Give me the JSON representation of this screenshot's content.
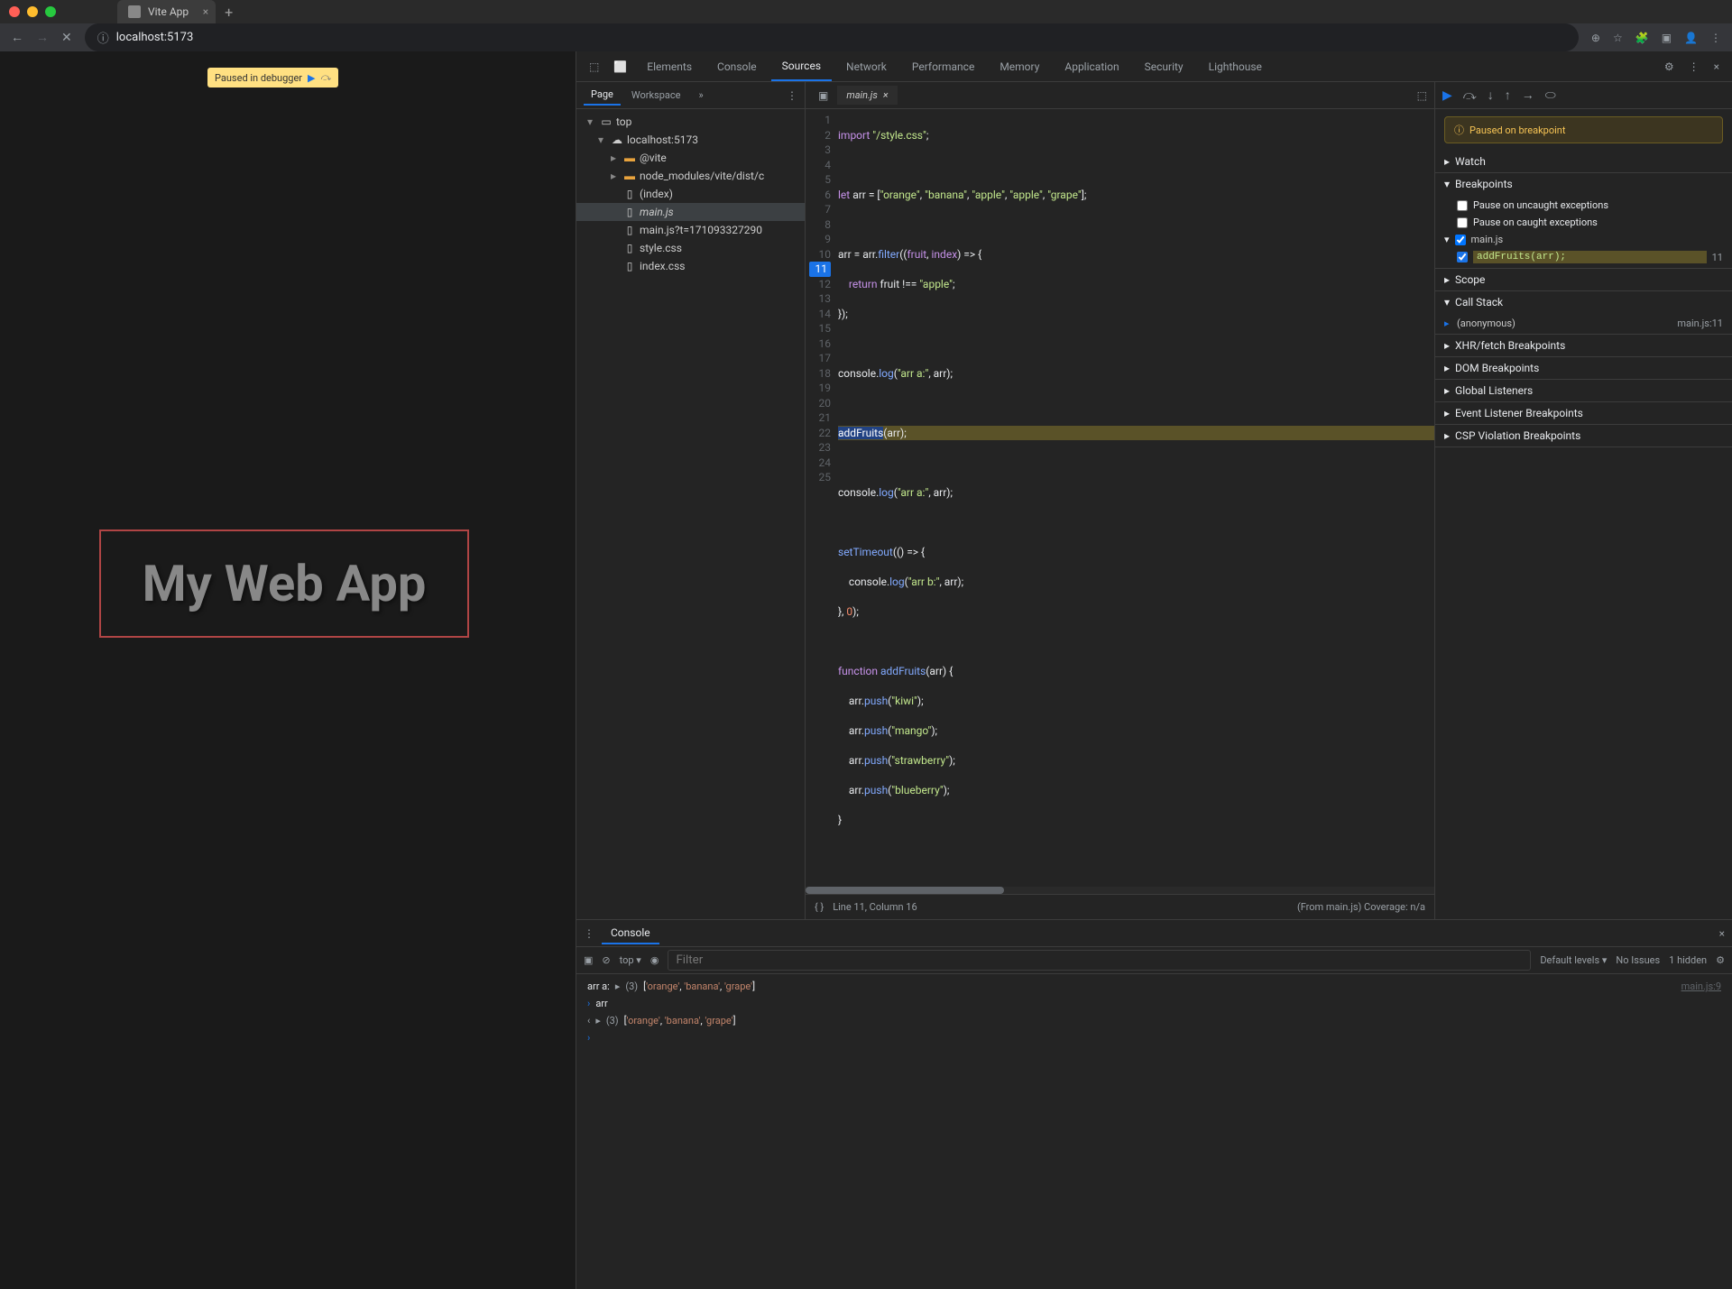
{
  "browser": {
    "tab_title": "Vite App",
    "url": "localhost:5173"
  },
  "page": {
    "paused_label": "Paused in debugger",
    "heading": "My Web App"
  },
  "devtools": {
    "tabs": [
      "Elements",
      "Console",
      "Sources",
      "Network",
      "Performance",
      "Memory",
      "Application",
      "Security",
      "Lighthouse"
    ],
    "active_tab": "Sources",
    "file_nav_tabs": [
      "Page",
      "Workspace"
    ],
    "tree": {
      "root": "top",
      "host": "localhost:5173",
      "vite": "@vite",
      "node_modules": "node_modules/vite/dist/c",
      "files": [
        "(index)",
        "main.js",
        "main.js?t=171093327290",
        "style.css",
        "index.css"
      ]
    },
    "editor": {
      "filename": "main.js",
      "status_left": "Line 11, Column 16",
      "status_right": "(From main.js) Coverage: n/a",
      "breakpoint_line": 11
    },
    "debugger": {
      "paused_msg": "Paused on breakpoint",
      "sections": {
        "watch": "Watch",
        "breakpoints": "Breakpoints",
        "scope": "Scope",
        "callstack": "Call Stack",
        "xhr": "XHR/fetch Breakpoints",
        "dom": "DOM Breakpoints",
        "global": "Global Listeners",
        "event": "Event Listener Breakpoints",
        "csp": "CSP Violation Breakpoints"
      },
      "bp_uncaught": "Pause on uncaught exceptions",
      "bp_caught": "Pause on caught exceptions",
      "bp_file": "main.js",
      "bp_code": "addFruits(arr);",
      "bp_line": "11",
      "callstack_fn": "(anonymous)",
      "callstack_loc": "main.js:11"
    },
    "console": {
      "tab": "Console",
      "context": "top",
      "filter_placeholder": "Filter",
      "levels": "Default levels",
      "issues": "No Issues",
      "hidden": "1 hidden",
      "log1_label": "arr a:",
      "log1_val": "(3) ['orange', 'banana', 'grape']",
      "log1_src": "main.js:9",
      "input": "arr",
      "result": "(3) ['orange', 'banana', 'grape']"
    }
  }
}
